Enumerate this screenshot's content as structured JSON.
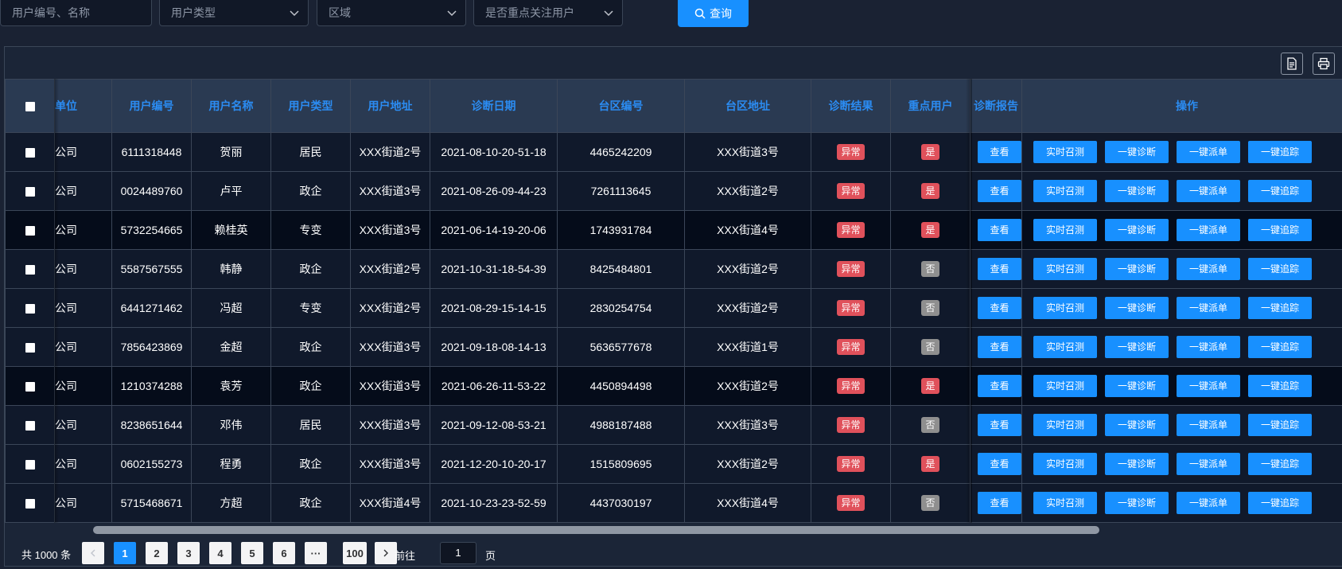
{
  "filters": {
    "user_search_placeholder": "用户编号、名称",
    "user_type_placeholder": "用户类型",
    "region_placeholder": "区域",
    "key_user_placeholder": "是否重点关注用户",
    "search_label": "查询"
  },
  "toolbar": {
    "export_icon": "document-icon",
    "print_icon": "printer-icon"
  },
  "table": {
    "headers": {
      "unit": "单位",
      "user_no": "用户编号",
      "user_name": "用户名称",
      "user_type": "用户类型",
      "address": "用户地址",
      "diag_date": "诊断日期",
      "area_no": "台区编号",
      "area_addr": "台区地址",
      "diag_result": "诊断结果",
      "key_user": "重点用户",
      "report": "诊断报告",
      "ops": "操作"
    },
    "buttons": {
      "view": "查看",
      "realtime": "实时召测",
      "diagnose": "一键诊断",
      "dispatch": "一键派单",
      "track": "一键追踪"
    },
    "rows": [
      {
        "unit": "公司",
        "user_no": "6111318448",
        "user_name": "贺丽",
        "user_type": "居民",
        "address": "XXX街道2号",
        "diag_date": "2021-08-10-20-51-18",
        "area_no": "4465242209",
        "area_addr": "XXX街道3号",
        "diag_result": "异常",
        "key_user": "是"
      },
      {
        "unit": "公司",
        "user_no": "0024489760",
        "user_name": "卢平",
        "user_type": "政企",
        "address": "XXX街道3号",
        "diag_date": "2021-08-26-09-44-23",
        "area_no": "7261113645",
        "area_addr": "XXX街道2号",
        "diag_result": "异常",
        "key_user": "是"
      },
      {
        "unit": "公司",
        "user_no": "5732254665",
        "user_name": "赖桂英",
        "user_type": "专变",
        "address": "XXX街道3号",
        "diag_date": "2021-06-14-19-20-06",
        "area_no": "1743931784",
        "area_addr": "XXX街道4号",
        "diag_result": "异常",
        "key_user": "是"
      },
      {
        "unit": "公司",
        "user_no": "5587567555",
        "user_name": "韩静",
        "user_type": "政企",
        "address": "XXX街道2号",
        "diag_date": "2021-10-31-18-54-39",
        "area_no": "8425484801",
        "area_addr": "XXX街道2号",
        "diag_result": "异常",
        "key_user": "否"
      },
      {
        "unit": "公司",
        "user_no": "6441271462",
        "user_name": "冯超",
        "user_type": "专变",
        "address": "XXX街道2号",
        "diag_date": "2021-08-29-15-14-15",
        "area_no": "2830254754",
        "area_addr": "XXX街道2号",
        "diag_result": "异常",
        "key_user": "否"
      },
      {
        "unit": "公司",
        "user_no": "7856423869",
        "user_name": "金超",
        "user_type": "政企",
        "address": "XXX街道3号",
        "diag_date": "2021-09-18-08-14-13",
        "area_no": "5636577678",
        "area_addr": "XXX街道1号",
        "diag_result": "异常",
        "key_user": "否"
      },
      {
        "unit": "公司",
        "user_no": "1210374288",
        "user_name": "袁芳",
        "user_type": "政企",
        "address": "XXX街道3号",
        "diag_date": "2021-06-26-11-53-22",
        "area_no": "4450894498",
        "area_addr": "XXX街道2号",
        "diag_result": "异常",
        "key_user": "是"
      },
      {
        "unit": "公司",
        "user_no": "8238651644",
        "user_name": "邓伟",
        "user_type": "居民",
        "address": "XXX街道3号",
        "diag_date": "2021-09-12-08-53-21",
        "area_no": "4988187488",
        "area_addr": "XXX街道3号",
        "diag_result": "异常",
        "key_user": "否"
      },
      {
        "unit": "公司",
        "user_no": "0602155273",
        "user_name": "程勇",
        "user_type": "政企",
        "address": "XXX街道3号",
        "diag_date": "2021-12-20-10-20-17",
        "area_no": "1515809695",
        "area_addr": "XXX街道2号",
        "diag_result": "异常",
        "key_user": "是"
      },
      {
        "unit": "公司",
        "user_no": "5715468671",
        "user_name": "方超",
        "user_type": "政企",
        "address": "XXX街道4号",
        "diag_date": "2021-10-23-23-52-59",
        "area_no": "4437030197",
        "area_addr": "XXX街道4号",
        "diag_result": "异常",
        "key_user": "否"
      }
    ]
  },
  "pagination": {
    "total": "共 1000 条",
    "pages": [
      "1",
      "2",
      "3",
      "4",
      "5",
      "6",
      "···",
      "100"
    ],
    "current": "1",
    "goto_prefix": "前往",
    "goto_value": "1",
    "goto_suffix": "页"
  }
}
